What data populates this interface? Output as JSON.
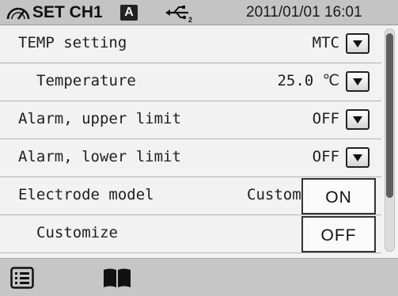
{
  "status": {
    "title": "SET CH1",
    "mode_badge": "A",
    "datetime": "2011/01/01 16:01",
    "icons": [
      "gauge-icon",
      "usb-icon"
    ]
  },
  "rows": [
    {
      "label": "TEMP setting",
      "value": "MTC",
      "has_dropdown": true
    },
    {
      "label": "Temperature",
      "value": "25.0 ℃",
      "has_dropdown": true
    },
    {
      "label": "Alarm, upper limit",
      "value": "OFF",
      "has_dropdown": true
    },
    {
      "label": "Alarm, lower limit",
      "value": "OFF",
      "has_dropdown": true
    },
    {
      "label": "Electrode model",
      "value": "Custom"
    },
    {
      "label": "Customize"
    }
  ],
  "popup": {
    "options": [
      "ON",
      "OFF"
    ]
  },
  "footer": {
    "icons": [
      "menu-list-icon",
      "book-icon"
    ]
  },
  "colors": {
    "statusbar_bg": "#c4c4c4",
    "list_bg": "#f2f2f2",
    "scroll_thumb": "#5e5e5e"
  }
}
